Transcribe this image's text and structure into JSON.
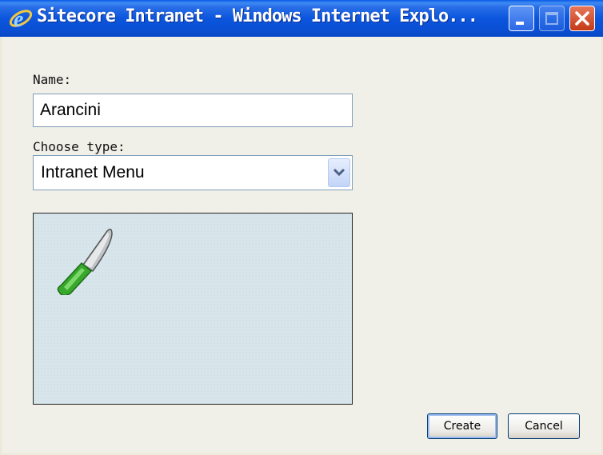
{
  "window": {
    "title": "Sitecore Intranet - Windows Internet Explo...",
    "icon": "ie-icon",
    "controls": [
      "minimize-icon",
      "maximize-icon",
      "close-icon"
    ]
  },
  "form": {
    "name_label": "Name:",
    "name_value": "Arancini",
    "type_label": "Choose type:",
    "type_value": "Intranet Menu"
  },
  "preview": {
    "icon": "knife-icon"
  },
  "buttons": {
    "create": "Create",
    "cancel": "Cancel"
  },
  "colors": {
    "titlebar": "#0b56dd",
    "close": "#c43a17",
    "preview_bg": "#d8e6ec"
  }
}
